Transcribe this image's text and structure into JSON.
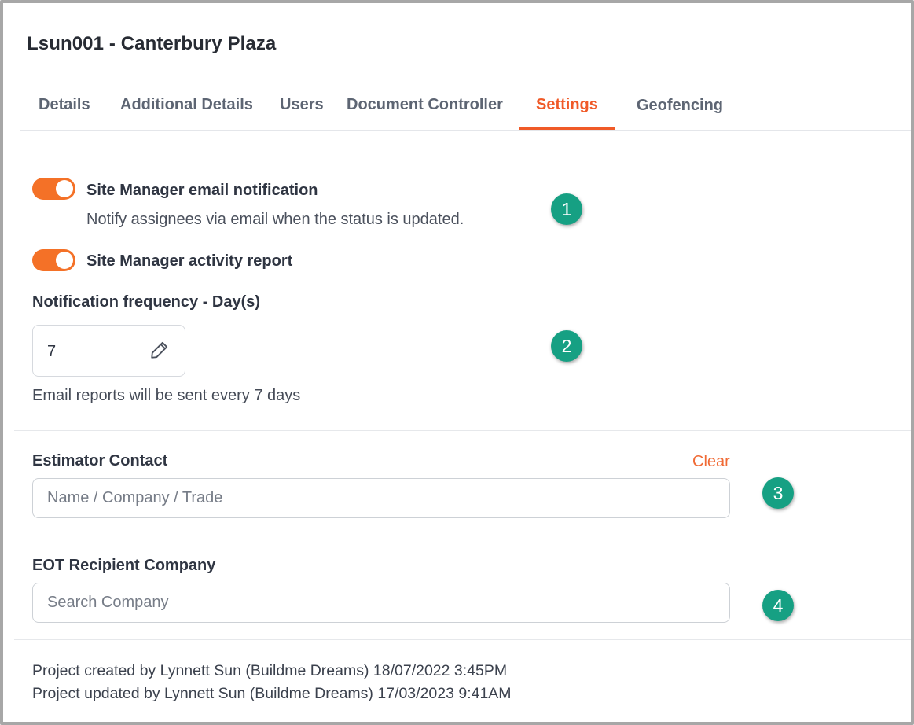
{
  "header": {
    "title": "Lsun001 - Canterbury Plaza"
  },
  "tabs": [
    {
      "label": "Details"
    },
    {
      "label": "Additional Details"
    },
    {
      "label": "Users"
    },
    {
      "label": "Document Controller"
    },
    {
      "label": "Settings",
      "active": true
    },
    {
      "label": "Geofencing"
    }
  ],
  "settings": {
    "email_notification": {
      "enabled": true,
      "label": "Site Manager email notification",
      "description": "Notify assignees via email when the status is updated."
    },
    "activity_report": {
      "enabled": true,
      "label": "Site Manager activity report"
    },
    "frequency": {
      "label": "Notification frequency - Day(s)",
      "value": "7",
      "help": "Email reports will be sent every 7 days"
    },
    "estimator_contact": {
      "label": "Estimator Contact",
      "clear_label": "Clear",
      "placeholder": "Name / Company / Trade"
    },
    "eot_recipient": {
      "label": "EOT Recipient Company",
      "placeholder": "Search Company"
    }
  },
  "badges": [
    "1",
    "2",
    "3",
    "4"
  ],
  "footer": {
    "created": "Project created by Lynnett Sun (Buildme Dreams) 18/07/2022 3:45PM",
    "updated": "Project updated by Lynnett Sun (Buildme Dreams) 17/03/2023 9:41AM"
  },
  "colors": {
    "accent": "#f05a28",
    "toggle_on": "#f47127",
    "badge": "#16a083"
  }
}
